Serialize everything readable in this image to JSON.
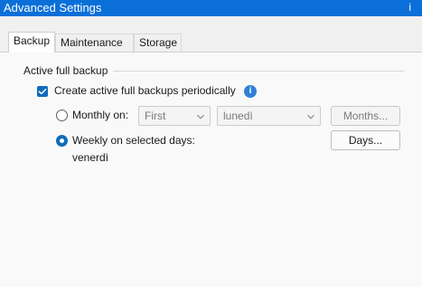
{
  "window": {
    "title": "Advanced Settings"
  },
  "tabs": [
    {
      "label": "Backup",
      "selected": true
    },
    {
      "label": "Maintenance",
      "selected": false
    },
    {
      "label": "Storage",
      "selected": false
    }
  ],
  "active_full_backup": {
    "group_title": "Active full backup",
    "periodic_checkbox": {
      "label": "Create active full backups periodically",
      "checked": true
    },
    "info_icon": "info-icon",
    "monthly": {
      "label": "Monthly on:",
      "selected": false,
      "week_select": "First",
      "day_select": "lunedì",
      "months_button": "Months..."
    },
    "weekly": {
      "label": "Weekly on selected days:",
      "selected": true,
      "days_button": "Days...",
      "selected_days": "venerdì"
    }
  },
  "colors": {
    "titlebar": "#0a6fd8",
    "accent": "#0f6cbd",
    "info": "#2f80d3"
  }
}
